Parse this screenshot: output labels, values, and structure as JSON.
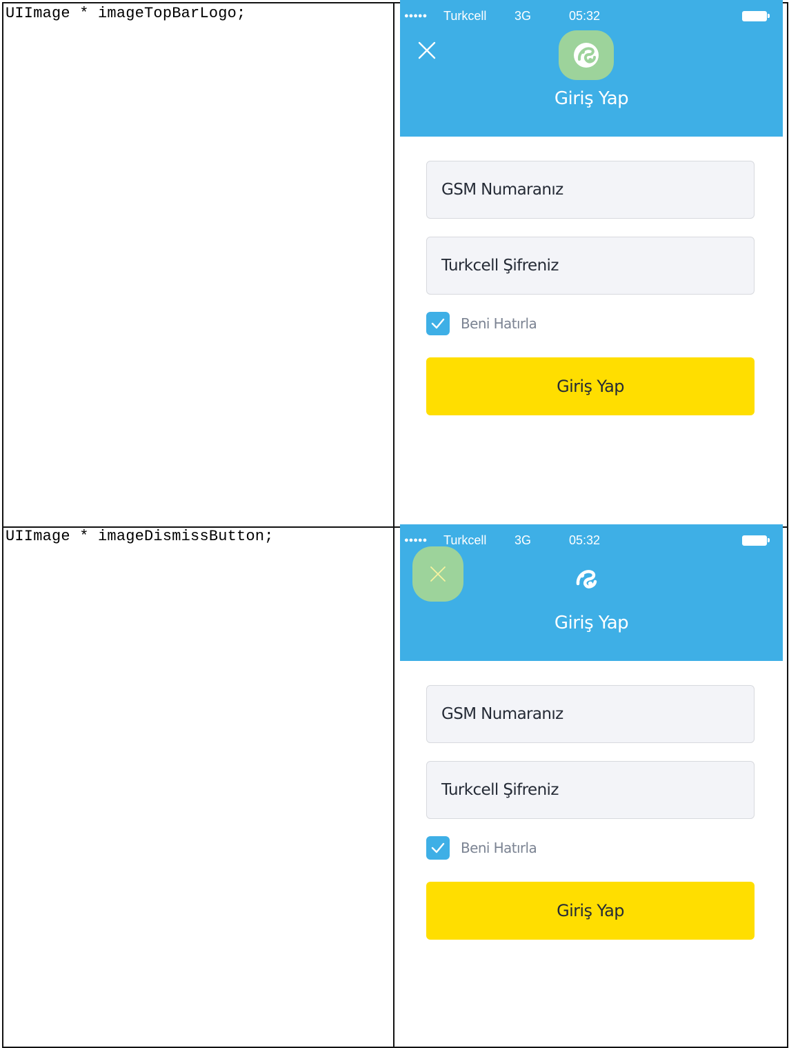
{
  "rows": [
    {
      "code": "UIImage * imageTopBarLogo;",
      "screen": {
        "status": {
          "signal": "●●●●●",
          "carrier": "Turkcell",
          "network": "3G",
          "time": "05:32"
        },
        "header_title": "Giriş Yap",
        "gsm_placeholder": "GSM Numaranız",
        "password_placeholder": "Turkcell Şifreniz",
        "remember_label": "Beni Hatırla",
        "remember_checked": true,
        "submit_label": "Giriş Yap"
      }
    },
    {
      "code": "UIImage * imageDismissButton;",
      "screen": {
        "status": {
          "signal": "●●●●●",
          "carrier": "Turkcell",
          "network": "3G",
          "time": "05:32"
        },
        "header_title": "Giriş Yap",
        "gsm_placeholder": "GSM Numaranız",
        "password_placeholder": "Turkcell Şifreniz",
        "remember_label": "Beni Hatırla",
        "remember_checked": true,
        "submit_label": "Giriş Yap"
      }
    }
  ],
  "icons": {
    "close": "close-icon",
    "logo": "turkcell-logo-icon",
    "battery": "battery-icon",
    "check": "check-icon"
  },
  "colors": {
    "header": "#3eafe6",
    "highlight": "#9dd39b",
    "button": "#ffde00",
    "field_bg": "#f3f4f8"
  }
}
